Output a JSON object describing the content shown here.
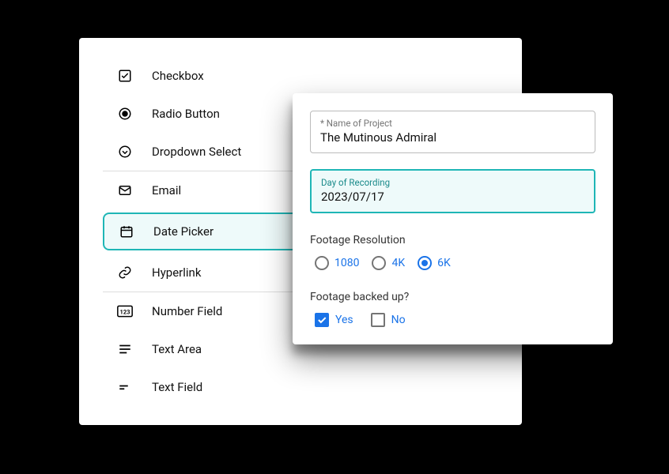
{
  "options": {
    "checkbox": "Checkbox",
    "radio": "Radio Button",
    "dropdown": "Dropdown Select",
    "email": "Email",
    "datepicker": "Date Picker",
    "hyperlink": "Hyperlink",
    "number": "Number Field",
    "textarea": "Text Area",
    "textfield": "Text Field"
  },
  "form": {
    "projectName": {
      "label": "* Name of Project",
      "value": "The Mutinous Admiral"
    },
    "recordingDay": {
      "label": "Day of Recording",
      "value": "2023/07/17"
    },
    "resolution": {
      "label": "Footage Resolution",
      "options": {
        "r1080": "1080",
        "r4k": "4K",
        "r6k": "6K"
      }
    },
    "backup": {
      "label": "Footage backed up?",
      "options": {
        "yes": "Yes",
        "no": "No"
      }
    }
  }
}
